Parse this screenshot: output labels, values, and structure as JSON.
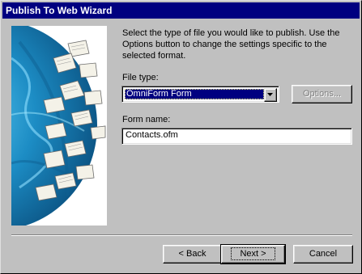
{
  "window": {
    "title": "Publish To Web Wizard"
  },
  "instructions": "Select the type of file you would like to publish. Use the Options button to change the settings specific to the selected format.",
  "file_type": {
    "label": "File type:",
    "selected": "OmniForm Form"
  },
  "options_button": {
    "label": "Options..."
  },
  "form_name": {
    "label": "Form name:",
    "value": "Contacts.ofm"
  },
  "buttons": {
    "back_prefix": "< ",
    "back_label": "Back",
    "next_label": "Next >",
    "cancel_label": "Cancel"
  },
  "colors": {
    "titlebar": "#000080",
    "face": "#c0c0c0",
    "globe": "#1f8fc8"
  }
}
